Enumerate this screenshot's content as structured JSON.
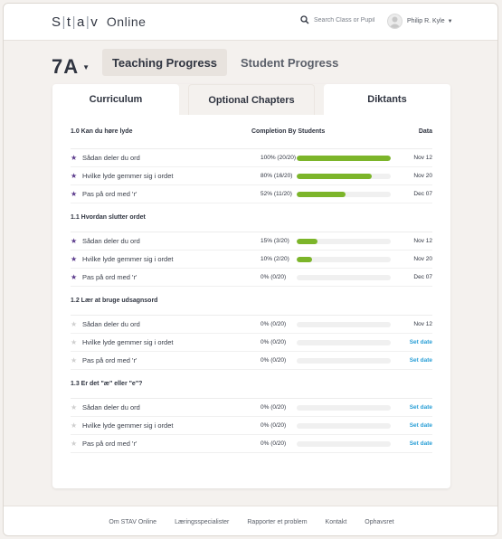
{
  "header": {
    "logo_letters": [
      "S",
      "t",
      "a",
      "v"
    ],
    "logo_online": "Online",
    "search_placeholder": "Search Class or Pupil",
    "user_name": "Philip R. Kyle"
  },
  "class": {
    "name": "7A"
  },
  "main_tabs": [
    {
      "label": "Teaching Progress",
      "active": true
    },
    {
      "label": "Student Progress",
      "active": false
    }
  ],
  "sub_tabs": [
    {
      "label": "Curriculum"
    },
    {
      "label": "Optional Chapters"
    },
    {
      "label": "Diktants"
    }
  ],
  "table": {
    "headers": {
      "title": "1.0 Kan du høre lyde",
      "completion": "Completion By Students",
      "date": "Data"
    },
    "sections": [
      {
        "title": "1.0 Kan du høre lyde",
        "rows": [
          {
            "name": "Sådan deler du ord",
            "starred": true,
            "pct": "100% (20/20)",
            "progress": 1.0,
            "date": "Nov 12",
            "set": false
          },
          {
            "name": "Hvilke lyde gemmer sig i ordet",
            "starred": true,
            "pct": "80% (16/20)",
            "progress": 0.8,
            "date": "Nov 20",
            "set": false
          },
          {
            "name": "Pas på ord med 'r'",
            "starred": true,
            "pct": "52% (11/20)",
            "progress": 0.52,
            "date": "Dec 07",
            "set": false
          }
        ]
      },
      {
        "title": "1.1 Hvordan slutter ordet",
        "rows": [
          {
            "name": "Sådan deler du ord",
            "starred": true,
            "pct": "15% (3/20)",
            "progress": 0.22,
            "date": "Nov 12",
            "set": false
          },
          {
            "name": "Hvilke lyde gemmer sig i ordet",
            "starred": true,
            "pct": "10% (2/20)",
            "progress": 0.16,
            "date": "Nov 20",
            "set": false
          },
          {
            "name": "Pas på ord med 'r'",
            "starred": true,
            "pct": "0% (0/20)",
            "progress": 0,
            "date": "Dec 07",
            "set": false
          }
        ]
      },
      {
        "title": "1.2 Lær at bruge udsagnsord",
        "rows": [
          {
            "name": "Sådan deler du ord",
            "starred": false,
            "pct": "0% (0/20)",
            "progress": 0,
            "date": "Nov 12",
            "set": false
          },
          {
            "name": "Hvilke lyde gemmer sig i ordet",
            "starred": false,
            "pct": "0% (0/20)",
            "progress": 0,
            "date": "Set date",
            "set": true
          },
          {
            "name": "Pas på ord med 'r'",
            "starred": false,
            "pct": "0% (0/20)",
            "progress": 0,
            "date": "Set date",
            "set": true
          }
        ]
      },
      {
        "title": "1.3 Er det \"æ\" eller \"e\"?",
        "rows": [
          {
            "name": "Sådan deler du ord",
            "starred": false,
            "pct": "0% (0/20)",
            "progress": 0,
            "date": "Set date",
            "set": true
          },
          {
            "name": "Hvilke lyde gemmer sig i ordet",
            "starred": false,
            "pct": "0% (0/20)",
            "progress": 0,
            "date": "Set date",
            "set": true
          },
          {
            "name": "Pas på ord med 'r'",
            "starred": false,
            "pct": "0% (0/20)",
            "progress": 0,
            "date": "Set date",
            "set": true
          }
        ]
      }
    ]
  },
  "footer": {
    "links": [
      "Om STAV Online",
      "Læringsspecialister",
      "Rapporter et problem",
      "Kontakt",
      "Ophavsret"
    ]
  },
  "colors": {
    "accent": "#7cb52a",
    "star": "#5b3b8c",
    "link": "#2a9fd6"
  }
}
